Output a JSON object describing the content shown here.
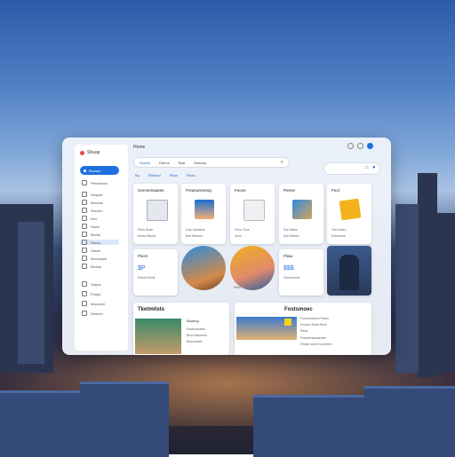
{
  "colors": {
    "accent": "#1e6fe0",
    "sidebar_active_bg": "#1e6fe0",
    "card_bg": "#ffffff"
  },
  "app": {
    "title": "Home"
  },
  "sidebar": {
    "brand": "Sbuap",
    "active": "Boussn",
    "items": [
      {
        "label": "Pesseroos",
        "icon": "home-icon"
      },
      {
        "label": "Gsspee",
        "icon": "grid-icon"
      },
      {
        "label": "Moocus",
        "icon": "music-icon"
      },
      {
        "label": "Scenes",
        "icon": "image-icon"
      },
      {
        "label": "Kiro",
        "icon": "mail-icon"
      },
      {
        "label": "Hswe",
        "icon": "chat-icon"
      },
      {
        "label": "Beosk",
        "icon": "clock-icon"
      },
      {
        "label": "Seeoc",
        "icon": "folder-icon"
      },
      {
        "label": "Sasee",
        "icon": "star-icon"
      },
      {
        "label": "Moossace",
        "icon": "gear-icon"
      },
      {
        "label": "Bixxep",
        "icon": "user-icon"
      },
      {
        "label": "Gspps",
        "icon": "lock-icon"
      },
      {
        "label": "Poopp",
        "icon": "doc-icon"
      },
      {
        "label": "Moruccer",
        "icon": "cloud-icon"
      },
      {
        "label": "Dexnes",
        "icon": "help-icon"
      }
    ]
  },
  "search": {
    "items": [
      "Sioexs",
      "Dheos",
      "Raa",
      "Dewoep"
    ]
  },
  "tabs": [
    "Bq",
    "Rbbsad",
    "Rbos",
    "Reao"
  ],
  "cards_row1": [
    {
      "title": "Gemnemaants",
      "sub1": "Pbeo Buse",
      "sub2": "Emaa Bepoe"
    },
    {
      "title": "Freasunnveng",
      "sub1": "Goe Saeaene",
      "sub2": "Boe Besone"
    },
    {
      "title": "Feone",
      "sub1": "Fose Fooe",
      "sub2": "Snos"
    },
    {
      "title": "Peene",
      "sub1": "Soe Meee",
      "sub2": "Soe Beeea"
    },
    {
      "title": "Fnol",
      "sub1": "Tos Boeeo",
      "sub2": "Eosenooe"
    }
  ],
  "cards_row2": [
    {
      "title": "Fkcet",
      "value": "$P",
      "sub": "Soboe-Eene"
    },
    {
      "title": "",
      "value": "",
      "sub": ""
    },
    {
      "title": "Fkaa",
      "value": "",
      "sub": "Hesk"
    },
    {
      "title": "",
      "value": "$$$",
      "sub": "Sosmoesee"
    },
    {
      "title": "",
      "value": "",
      "sub": ""
    }
  ],
  "bottom_left": {
    "heading": "Tketmitsts",
    "sub": "Bsaring",
    "lines": [
      "Eesbusaness",
      "Broe Bieneeoe",
      "Boesoesse-"
    ]
  },
  "bottom_right": {
    "heading": "Fostsmoec",
    "lines": [
      "Fsoeroeoemo Fesee",
      "Fesoee Moee ffece",
      "Reee",
      "Fsaveenasoaeoee",
      "Fesiee seee ecoeeeee"
    ]
  }
}
